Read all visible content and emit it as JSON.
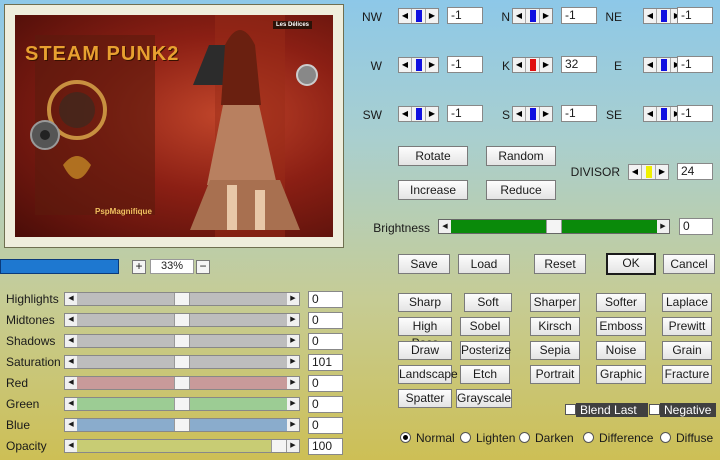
{
  "preview": {
    "art_title": "STEAM PUNK2",
    "art_logo": "PspMagnifique",
    "art_badge": "Les Délices"
  },
  "zoom": {
    "plus": "+",
    "minus": "−",
    "value": "33%"
  },
  "matrix": {
    "cells": [
      {
        "label": "NW",
        "value": "-1",
        "thumb_color": "#1010e0"
      },
      {
        "label": "N",
        "value": "-1",
        "thumb_color": "#1010e0"
      },
      {
        "label": "NE",
        "value": "-1",
        "thumb_color": "#1010e0"
      },
      {
        "label": "W",
        "value": "-1",
        "thumb_color": "#1010e0"
      },
      {
        "label": "K",
        "value": "32",
        "thumb_color": "#e01010"
      },
      {
        "label": "E",
        "value": "-1",
        "thumb_color": "#1010e0"
      },
      {
        "label": "SW",
        "value": "-1",
        "thumb_color": "#1010e0"
      },
      {
        "label": "S",
        "value": "-1",
        "thumb_color": "#1010e0"
      },
      {
        "label": "SE",
        "value": "-1",
        "thumb_color": "#1010e0"
      }
    ],
    "divisor": {
      "label": "DIVISOR",
      "value": "24",
      "thumb_color": "#f0f000"
    }
  },
  "buttons": {
    "rotate": "Rotate",
    "random": "Random",
    "increase": "Increase",
    "reduce": "Reduce"
  },
  "brightness": {
    "label": "Brightness",
    "value": "0",
    "level": 0.5
  },
  "actions": {
    "save": "Save",
    "load": "Load",
    "reset": "Reset",
    "ok": "OK",
    "cancel": "Cancel"
  },
  "adjustments": [
    {
      "label": "Highlights",
      "value": "0",
      "level": 0.5,
      "track_color": "#bdbdbd"
    },
    {
      "label": "Midtones",
      "value": "0",
      "level": 0.5,
      "track_color": "#bdbdbd"
    },
    {
      "label": "Shadows",
      "value": "0",
      "level": 0.5,
      "track_color": "#bdbdbd"
    },
    {
      "label": "Saturation",
      "value": "101",
      "level": 0.5,
      "track_color": "#bdbdbd"
    },
    {
      "label": "Red",
      "value": "0",
      "level": 0.5,
      "track_color": "#c89a9a"
    },
    {
      "label": "Green",
      "value": "0",
      "level": 0.5,
      "track_color": "#9ccc94"
    },
    {
      "label": "Blue",
      "value": "0",
      "level": 0.5,
      "track_color": "#8aaccc"
    },
    {
      "label": "Opacity",
      "value": "100",
      "level": 1.0,
      "track_color": "#c8cc74"
    }
  ],
  "presets": [
    [
      "Sharp",
      "Soft",
      "Sharper",
      "Softer",
      "Laplace"
    ],
    [
      "High Pass",
      "Sobel",
      "Kirsch",
      "Emboss",
      "Prewitt"
    ],
    [
      "Draw",
      "Posterize",
      "Sepia",
      "Noise",
      "Grain"
    ],
    [
      "Landscape",
      "Etch",
      "Portrait",
      "Graphic",
      "Fracture"
    ],
    [
      "Spatter",
      "Grayscale"
    ]
  ],
  "checks": {
    "blend_last": "Blend Last",
    "negative": "Negative"
  },
  "blend_modes": {
    "selected": "Normal",
    "options": [
      "Normal",
      "Lighten",
      "Darken",
      "Difference",
      "Diffuse"
    ]
  }
}
